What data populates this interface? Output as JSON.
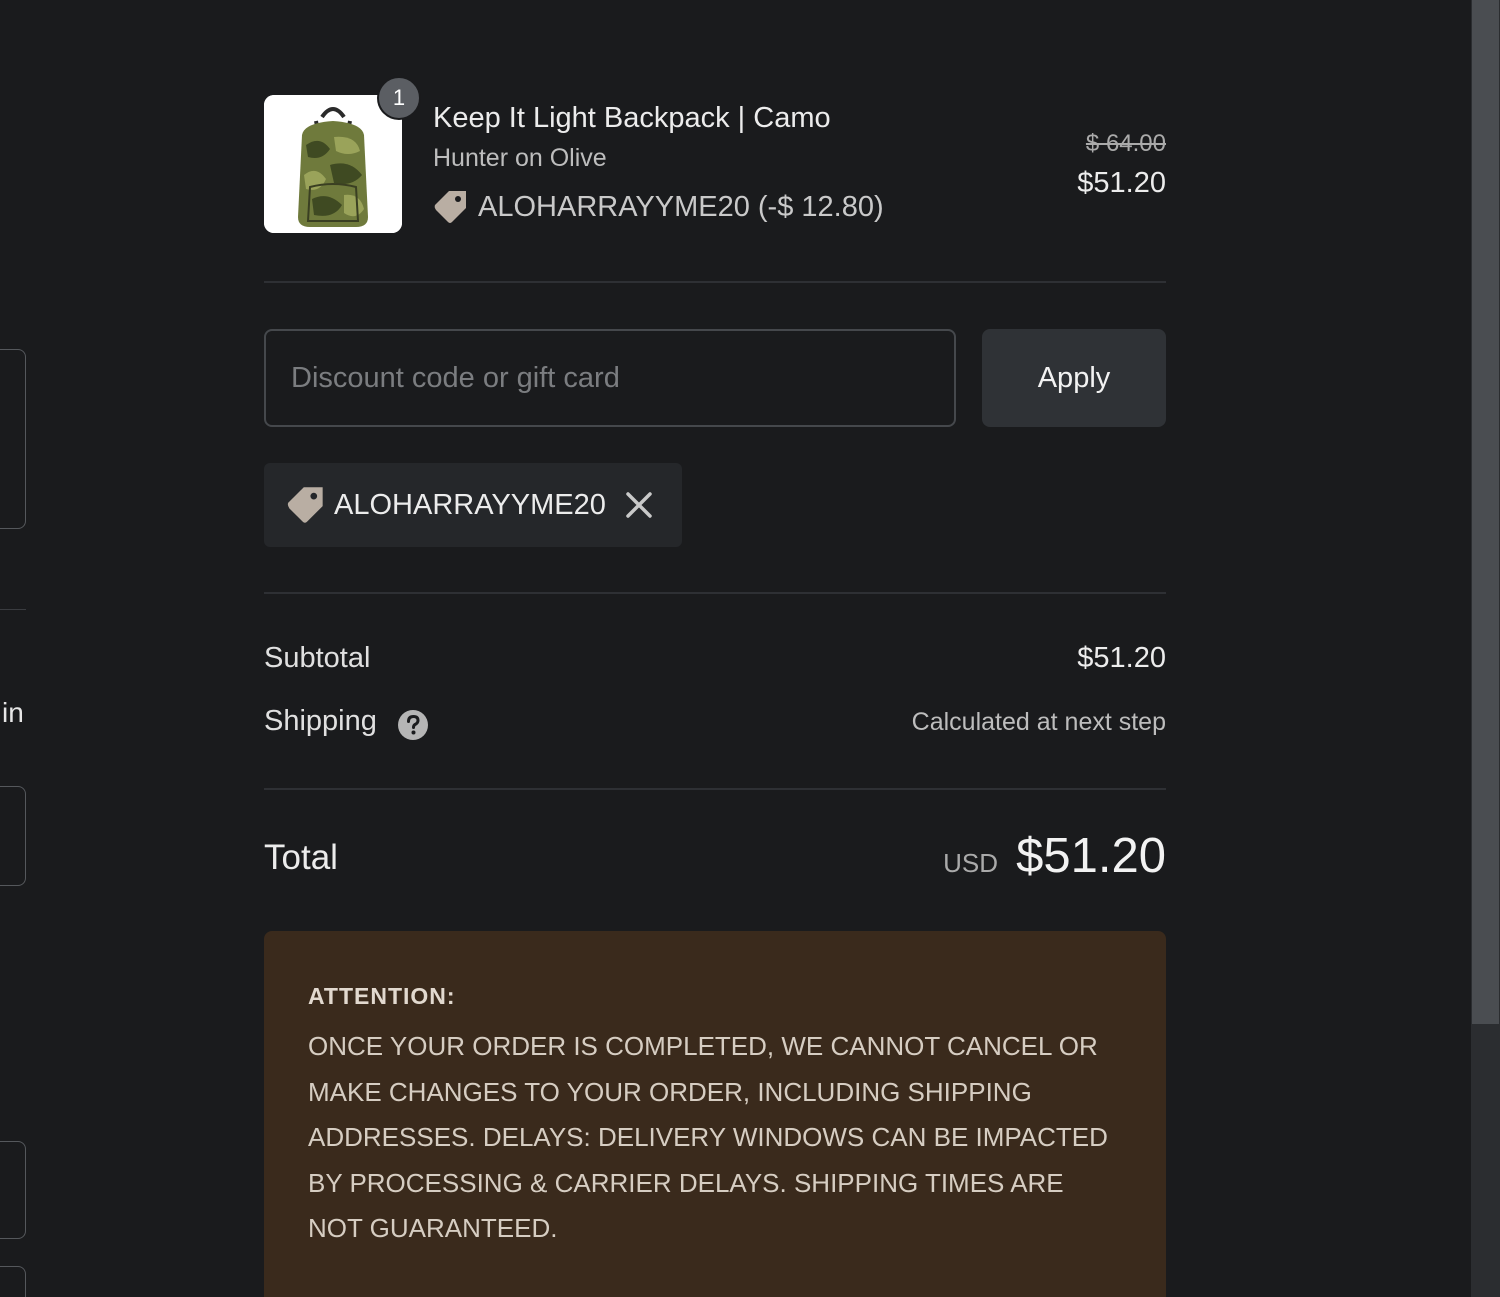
{
  "product": {
    "quantity": "1",
    "name": "Keep It Light Backpack | Camo",
    "variant": "Hunter on Olive",
    "discount_line": "ALOHARRAYYME20 (-$ 12.80)",
    "original_price": "$ 64.00",
    "final_price": "$51.20"
  },
  "discount_form": {
    "placeholder": "Discount code or gift card",
    "value": "",
    "apply_label": "Apply"
  },
  "applied_discount": {
    "code": "ALOHARRAYYME20"
  },
  "summary": {
    "subtotal_label": "Subtotal",
    "subtotal_value": "$51.20",
    "shipping_label": "Shipping",
    "shipping_value": "Calculated at next step",
    "total_label": "Total",
    "total_currency": "USD",
    "total_value": "$51.20"
  },
  "notice": {
    "title": "ATTENTION:",
    "body": "ONCE YOUR ORDER IS COMPLETED, WE CANNOT CANCEL OR MAKE CHANGES TO YOUR ORDER, INCLUDING SHIPPING ADDRESSES. DELAYS: DELIVERY WINDOWS CAN BE IMPACTED BY PROCESSING & CARRIER DELAYS. SHIPPING TIMES ARE NOT GUARANTEED."
  },
  "left_column": {
    "partial_text": "in"
  },
  "icons": {
    "tag": "tag-icon",
    "remove": "close-icon",
    "help": "question-circle-icon"
  },
  "colors": {
    "background": "#1a1b1d",
    "notice_background": "#3a2a1c",
    "button_background": "#2f3236",
    "tag": "#b9aea3"
  }
}
